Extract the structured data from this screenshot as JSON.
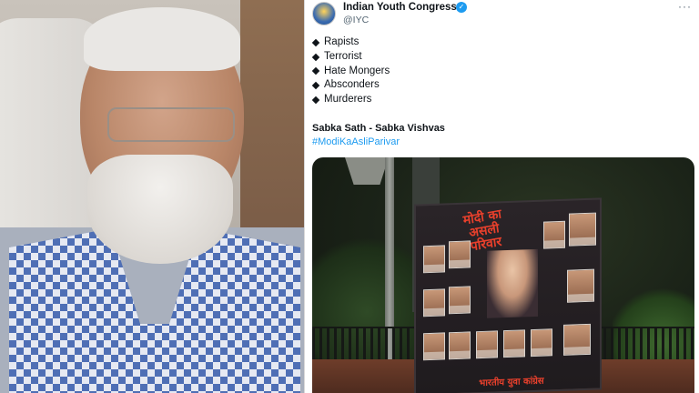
{
  "tweet": {
    "author_name": "Indian Youth Congress",
    "author_handle": "@IYC",
    "verified_icon": "verified-badge-icon",
    "more_icon": "more-options-icon",
    "list_items": [
      "Rapists",
      "Terrorist",
      "Hate Mongers",
      "Absconders",
      "Murderers"
    ],
    "slogan": "Sabka Sath - Sabka Vishvas",
    "hashtag": "#ModiKaAsliParivar"
  },
  "poster": {
    "title": "मोदी का असली परिवार",
    "footer": "भारतीय युवा कांग्रेस"
  },
  "colors": {
    "hashtag_blue": "#1d9bf0",
    "poster_red": "#e8402c",
    "verified_blue": "#1d9bf0"
  }
}
